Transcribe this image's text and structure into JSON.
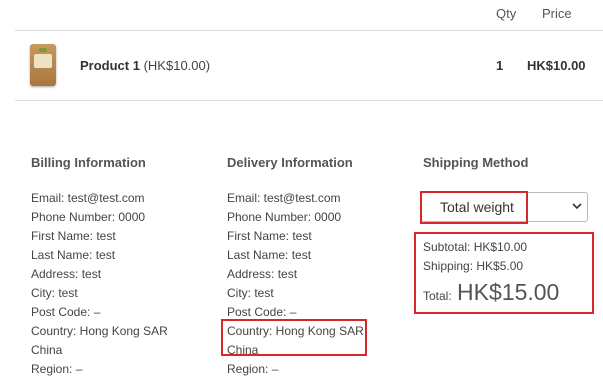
{
  "header": {
    "qty_label": "Qty",
    "price_label": "Price"
  },
  "product": {
    "name": "Product 1",
    "unit_price": "(HK$10.00)",
    "qty": "1",
    "price": "HK$10.00",
    "thumbnail_icon": "product-thumbnail"
  },
  "billing": {
    "title": "Billing Information",
    "lines": [
      "Email: test@test.com",
      "Phone Number: 0000",
      "First Name: test",
      "Last Name: test",
      "Address: test",
      "City: test",
      "Post Code: –",
      "Country: Hong Kong SAR",
      "China",
      "Region: –"
    ]
  },
  "delivery": {
    "title": "Delivery Information",
    "lines": [
      "Email: test@test.com",
      "Phone Number: 0000",
      "First Name: test",
      "Last Name: test",
      "Address: test",
      "City: test",
      "Post Code: –",
      "Country: Hong Kong SAR",
      "China",
      "Region: –"
    ]
  },
  "shipping": {
    "title": "Shipping Method",
    "selected": "Total weight",
    "subtotal": "Subtotal: HK$10.00",
    "shipping": "Shipping: HK$5.00",
    "total_label": "Total:",
    "total_amount": "HK$15.00"
  },
  "colors": {
    "highlight": "#d9262c",
    "divider": "#dddddd",
    "text": "#444444"
  }
}
